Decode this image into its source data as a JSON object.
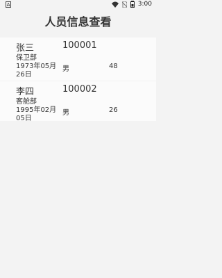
{
  "status_bar": {
    "time": "3:00"
  },
  "header": {
    "title": "人员信息查看"
  },
  "people": [
    {
      "name": "张三",
      "id": "100001",
      "department": "保卫部",
      "birthdate": "1973年05月26日",
      "gender": "男",
      "age": "48"
    },
    {
      "name": "李四",
      "id": "100002",
      "department": "客舱部",
      "birthdate": "1995年02月05日",
      "gender": "男",
      "age": "26"
    }
  ]
}
